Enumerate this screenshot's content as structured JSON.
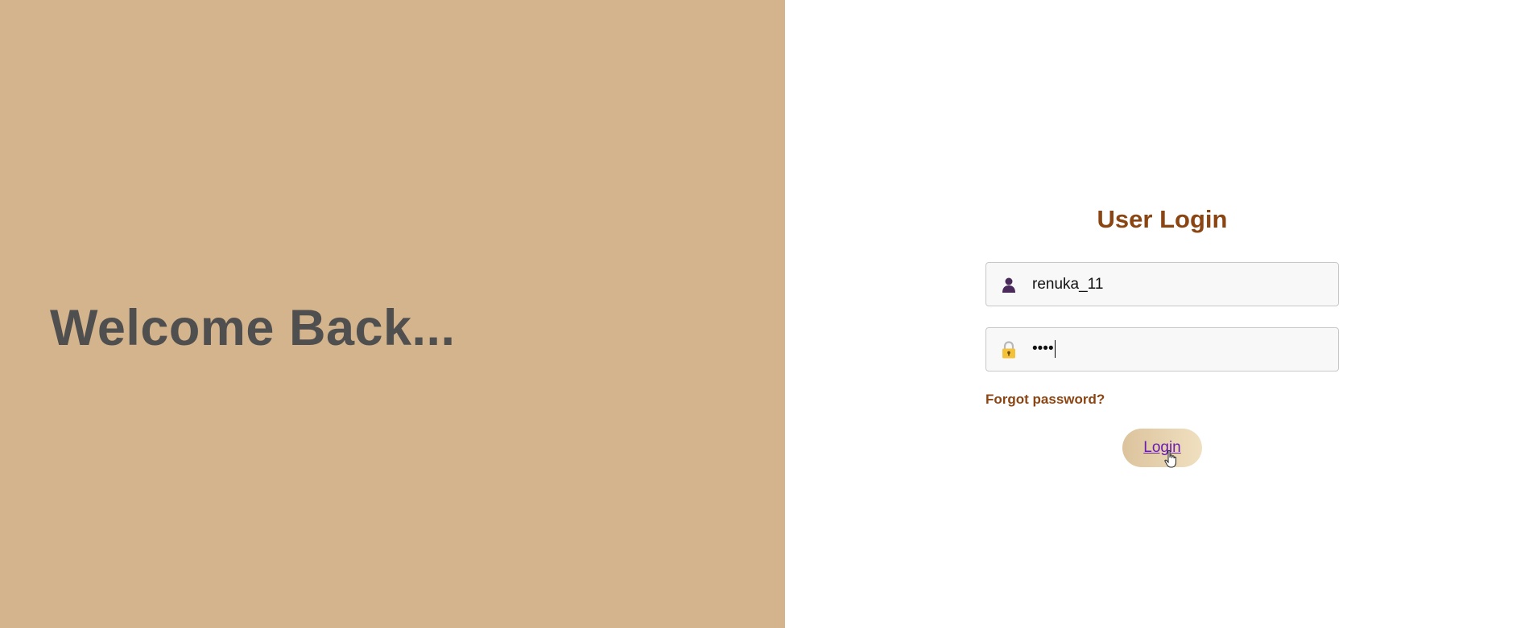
{
  "left": {
    "welcome_text": "Welcome Back..."
  },
  "login": {
    "title": "User Login",
    "username_value": "renuka_11",
    "password_value": "••••",
    "forgot_label": "Forgot password?",
    "login_label": "Login"
  },
  "colors": {
    "left_panel_bg": "#d3b48c",
    "accent_brown": "#8b4513",
    "welcome_text": "#4f4f4f",
    "link_purple": "#6a1bb0"
  },
  "icons": {
    "username": "user-icon",
    "password": "lock-icon",
    "pointer": "hand-cursor-icon"
  }
}
